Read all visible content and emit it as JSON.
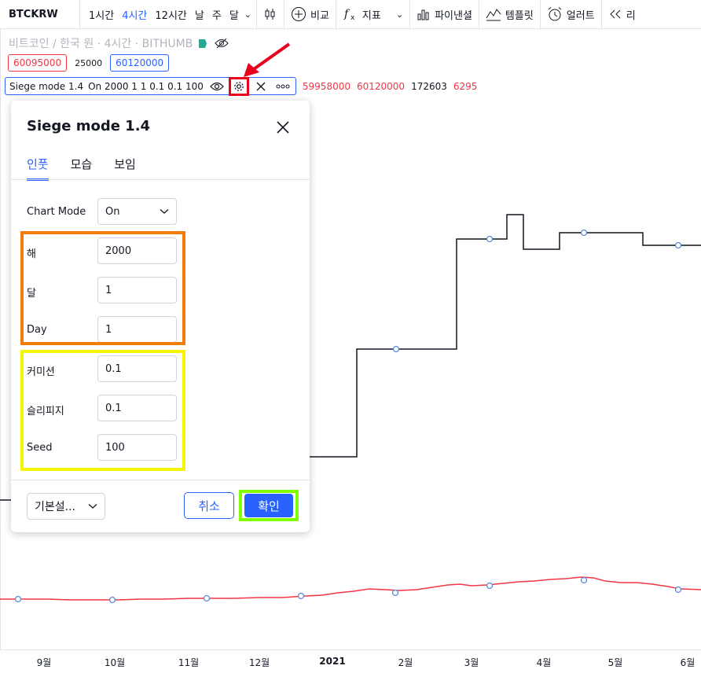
{
  "toolbar": {
    "symbol": "BTCKRW",
    "intervals": [
      "1시간",
      "4시간",
      "12시간",
      "날",
      "주",
      "달"
    ],
    "active_interval": "4시간",
    "compare_label": "비교",
    "indicators_label": "지표",
    "pine_label": "파이낸셜",
    "templates_label": "템플릿",
    "alert_label": "얼러트",
    "replay_label": "리"
  },
  "legend": {
    "title": "비트코인 / 한국 원 · 4시간 · BITHUMB",
    "bid": "60095000",
    "spread": "25000",
    "ask": "60120000"
  },
  "indicator": {
    "name": "Siege mode 1.4",
    "params": "On 2000 1 1 0.1 0.1 100",
    "values": [
      "59958000",
      "60120000",
      "172603",
      "6295"
    ]
  },
  "dialog": {
    "title": "Siege mode 1.4",
    "tabs": [
      "인풋",
      "모습",
      "보임"
    ],
    "active_tab": "인풋",
    "chart_mode_label": "Chart Mode",
    "chart_mode_value": "On",
    "fields": [
      {
        "label": "해",
        "value": "2000"
      },
      {
        "label": "달",
        "value": "1"
      },
      {
        "label": "Day",
        "value": "1"
      },
      {
        "label": "커미션",
        "value": "0.1"
      },
      {
        "label": "슬리피지",
        "value": "0.1"
      },
      {
        "label": "Seed",
        "value": "100"
      }
    ],
    "defaults_label": "기본설...",
    "cancel_label": "취소",
    "ok_label": "확인"
  },
  "xaxis": {
    "ticks": [
      "9월",
      "10월",
      "11월",
      "12월",
      "2021",
      "2월",
      "3월",
      "4월",
      "5월",
      "6월"
    ]
  },
  "colors": {
    "accent": "#2962ff",
    "down": "#f23645",
    "highlight_red": "#e8001c",
    "highlight_orange": "#f47c0a",
    "highlight_yellow": "#f5f501",
    "highlight_green": "#7fff00"
  }
}
